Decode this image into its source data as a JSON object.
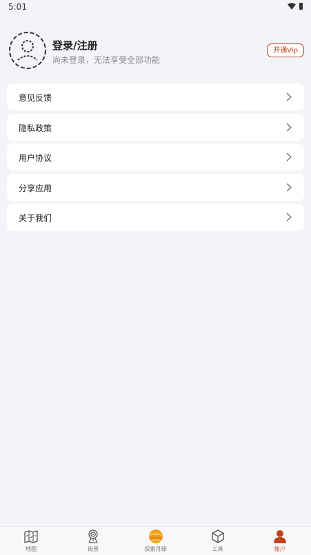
{
  "status_bar": {
    "time": "5:01"
  },
  "profile": {
    "title": "登录/注册",
    "subtitle": "尚未登录，无法享受全部功能",
    "vip_label": "开通Vip"
  },
  "menu": [
    {
      "label": "意见反馈"
    },
    {
      "label": "隐私政策"
    },
    {
      "label": "用户协议"
    },
    {
      "label": "分享应用"
    },
    {
      "label": "关于我们"
    }
  ],
  "tabs": [
    {
      "label": "地图",
      "icon": "map-icon"
    },
    {
      "label": "街景",
      "icon": "street-view-icon"
    },
    {
      "label": "探索月球",
      "icon": "moon-icon"
    },
    {
      "label": "工具",
      "icon": "cube-icon"
    },
    {
      "label": "账户",
      "icon": "account-icon",
      "active": true
    }
  ],
  "colors": {
    "accent": "#c0441e",
    "background": "#f3f4f8"
  }
}
